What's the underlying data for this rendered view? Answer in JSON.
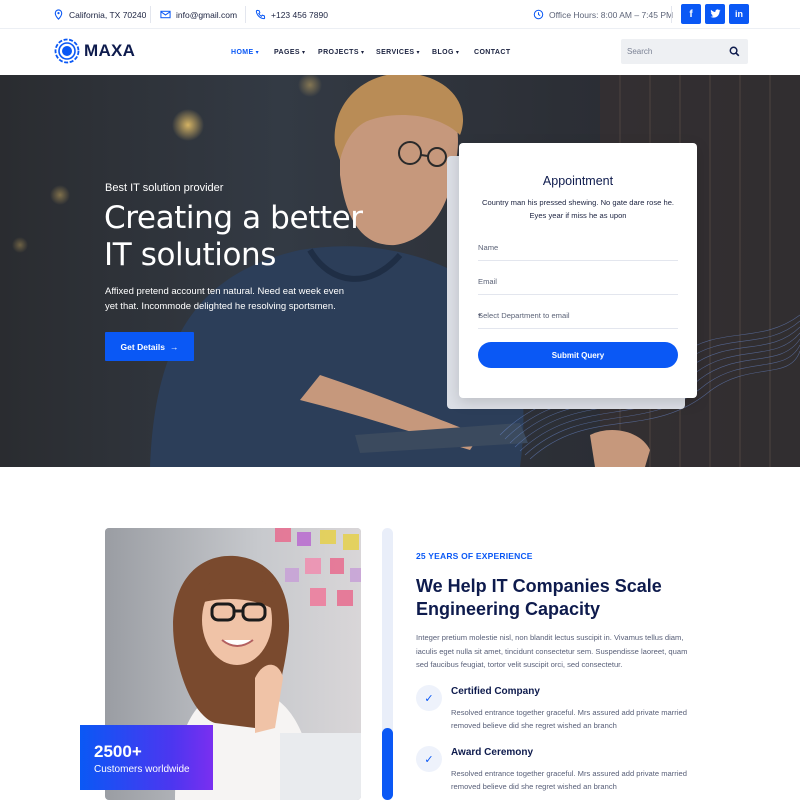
{
  "topbar": {
    "location": "California, TX 70240",
    "email": "info@gmail.com",
    "phone": "+123 456 7890",
    "hours": "Office Hours: 8:00 AM – 7:45 PM",
    "social": [
      {
        "icon": "facebook-icon",
        "label": "f"
      },
      {
        "icon": "twitter-icon",
        "label": "t"
      },
      {
        "icon": "linkedin-icon",
        "label": "in"
      }
    ]
  },
  "brand": {
    "name": "MAXA"
  },
  "nav": {
    "items": [
      {
        "label": "HOME",
        "dropdown": true,
        "active": true
      },
      {
        "label": "PAGES",
        "dropdown": true
      },
      {
        "label": "PROJECTS",
        "dropdown": true
      },
      {
        "label": "SERVICES",
        "dropdown": true
      },
      {
        "label": "BLOG",
        "dropdown": true
      },
      {
        "label": "CONTACT",
        "dropdown": false
      }
    ],
    "search_placeholder": "Search"
  },
  "hero": {
    "subtitle": "Best IT solution provider",
    "title_line1": "Creating a better",
    "title_line2": "IT solutions",
    "text": "Affixed pretend account ten natural. Need eat week even yet that. Incommode delighted he resolving sportsmen.",
    "button": "Get Details",
    "button_icon": "arrow-right-icon"
  },
  "appointment": {
    "title": "Appointment",
    "text": "Country man his pressed shewing. No gate dare rose he. Eyes year if miss he as upon",
    "name_placeholder": "Name",
    "email_placeholder": "Email",
    "department_placeholder": "Select Department to email",
    "submit": "Submit Query"
  },
  "about": {
    "badge_number": "2500+",
    "badge_label": "Customers worldwide",
    "eyebrow": "25 YEARS OF EXPERIENCE",
    "title": "We Help IT Companies Scale Engineering Capacity",
    "text": "Integer pretium molestie nisl, non blandit lectus suscipit in. Vivamus tellus diam, iaculis eget nulla sit amet, tincidunt consectetur sem. Suspendisse laoreet, quam sed faucibus feugiat, tortor velit suscipit orci, sed consectetur.",
    "features": [
      {
        "title": "Certified Company",
        "text": "Resolved entrance together graceful. Mrs assured add private married removed believe did she regret wished an branch"
      },
      {
        "title": "Award Ceremony",
        "text": "Resolved entrance together graceful. Mrs assured add private married removed believe did she regret wished an branch"
      }
    ]
  },
  "colors": {
    "accent": "#0a58f5",
    "navy": "#0e1b4d"
  }
}
